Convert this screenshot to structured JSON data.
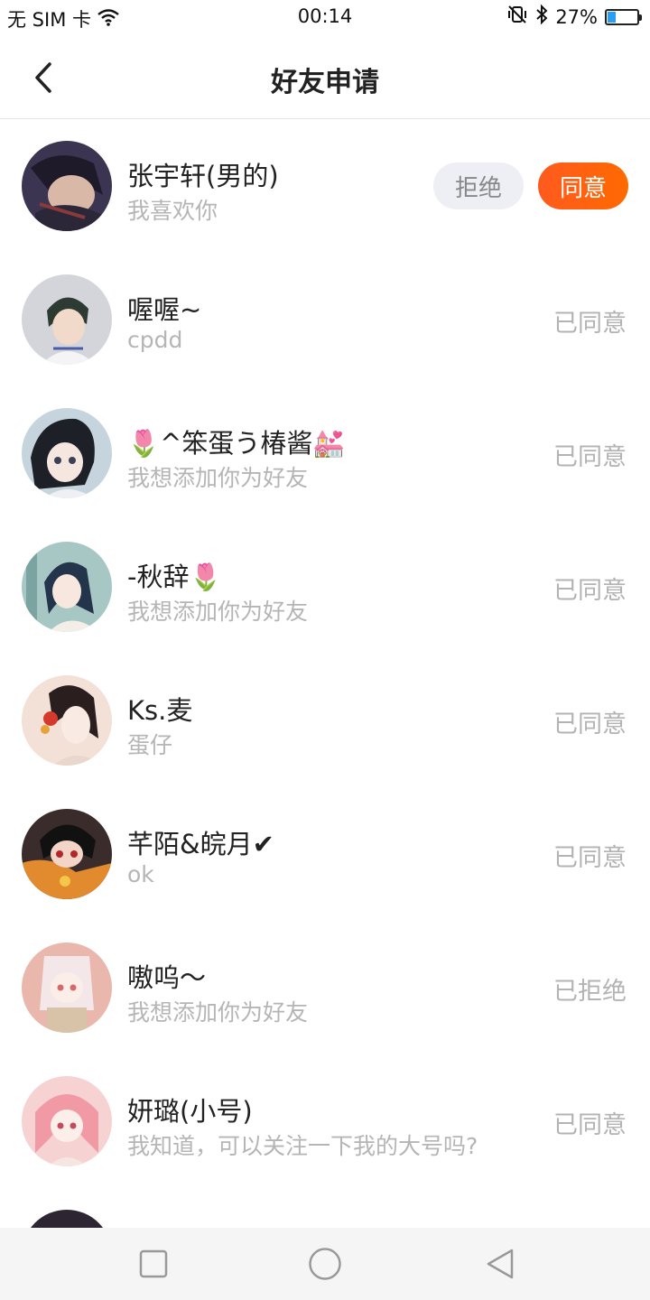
{
  "status_bar": {
    "carrier": "无 SIM 卡",
    "time": "00:14",
    "battery": "27%",
    "battery_level": 0.27
  },
  "header": {
    "title": "好友申请"
  },
  "requests": [
    {
      "name": "张宇轩(男的)",
      "message": "我喜欢你",
      "reject_label": "拒绝",
      "accept_label": "同意",
      "avatar_color": "#3b3552"
    },
    {
      "name": "喔喔~",
      "message": "cpdd",
      "status": "已同意",
      "avatar_color": "#c9ccd3"
    },
    {
      "name": "🌷^笨蛋う椿酱💒",
      "message": "我想添加你为好友",
      "status": "已同意",
      "avatar_color": "#bfcfd9"
    },
    {
      "name": "-秋辞🌷",
      "message": "我想添加你为好友",
      "status": "已同意",
      "avatar_color": "#9dbfbe"
    },
    {
      "name": "Ks.麦",
      "message": "蛋仔",
      "status": "已同意",
      "avatar_color": "#f1d6c9"
    },
    {
      "name": "芊陌&皖月✔",
      "message": "ok",
      "status": "已同意",
      "avatar_color": "#e08a2e"
    },
    {
      "name": "嗷呜～",
      "message": "我想添加你为好友",
      "status": "已拒绝",
      "avatar_color": "#e7b3a9"
    },
    {
      "name": "妍璐(小号)",
      "message": "我知道，可以关注一下我的大号吗?",
      "status": "已同意",
      "avatar_color": "#f2b6b6"
    }
  ],
  "partial_avatar_color": "#2e2533"
}
